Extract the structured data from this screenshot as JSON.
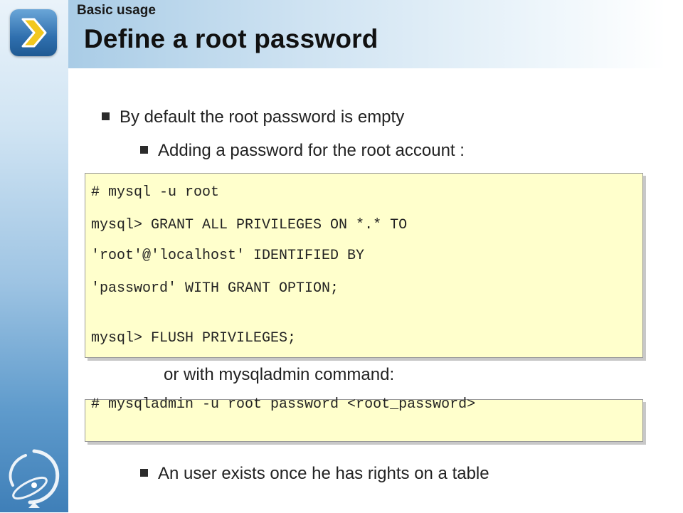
{
  "header": {
    "section_label": "Basic usage",
    "title": "Define a root password"
  },
  "icons": {
    "nav": "chevron-right-icon",
    "logo": "orbit-logo-icon"
  },
  "colors": {
    "code_background": "#ffffcc",
    "sidebar_blue": "#3f7fb8",
    "title_text": "#111111"
  },
  "bullets": {
    "default_empty": "By default the root password is empty",
    "adding_password": "Adding a password for the root account :",
    "or_mysqladmin": "or with mysqladmin command:",
    "user_exists": "An user exists once he has rights on a table"
  },
  "code_block_1": {
    "lines": [
      "# mysql -u root",
      "mysql> GRANT ALL PRIVILEGES ON *.* TO",
      "'root'@'localhost' IDENTIFIED BY",
      "'password' WITH GRANT OPTION;",
      "mysql> FLUSH PRIVILEGES;"
    ]
  },
  "code_block_2": {
    "lines": [
      "# mysqladmin -u root password <root_password>"
    ]
  }
}
